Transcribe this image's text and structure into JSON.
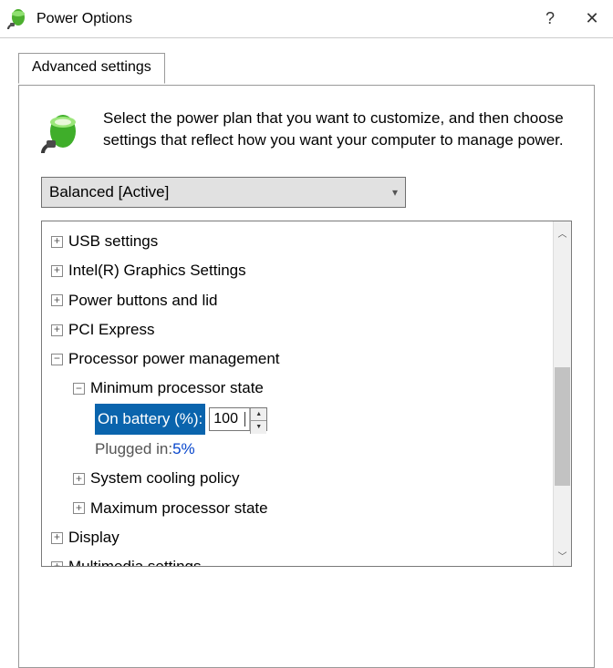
{
  "window": {
    "title": "Power Options",
    "help": "?",
    "close": "✕"
  },
  "tab": {
    "label": "Advanced settings"
  },
  "intro": "Select the power plan that you want to customize, and then choose settings that reflect how you want your computer to manage power.",
  "combo": {
    "selected": "Balanced [Active]"
  },
  "tree": {
    "usb": "USB settings",
    "graphics": "Intel(R) Graphics Settings",
    "buttons": "Power buttons and lid",
    "pci": "PCI Express",
    "proc": "Processor power management",
    "minstate": "Minimum processor state",
    "onbatt_label": "On battery (%):",
    "onbatt_value": "100",
    "plugged_label": "Plugged in: ",
    "plugged_value": "5%",
    "cooling": "System cooling policy",
    "maxstate": "Maximum processor state",
    "display": "Display",
    "multimedia": "Multimedia settings"
  }
}
